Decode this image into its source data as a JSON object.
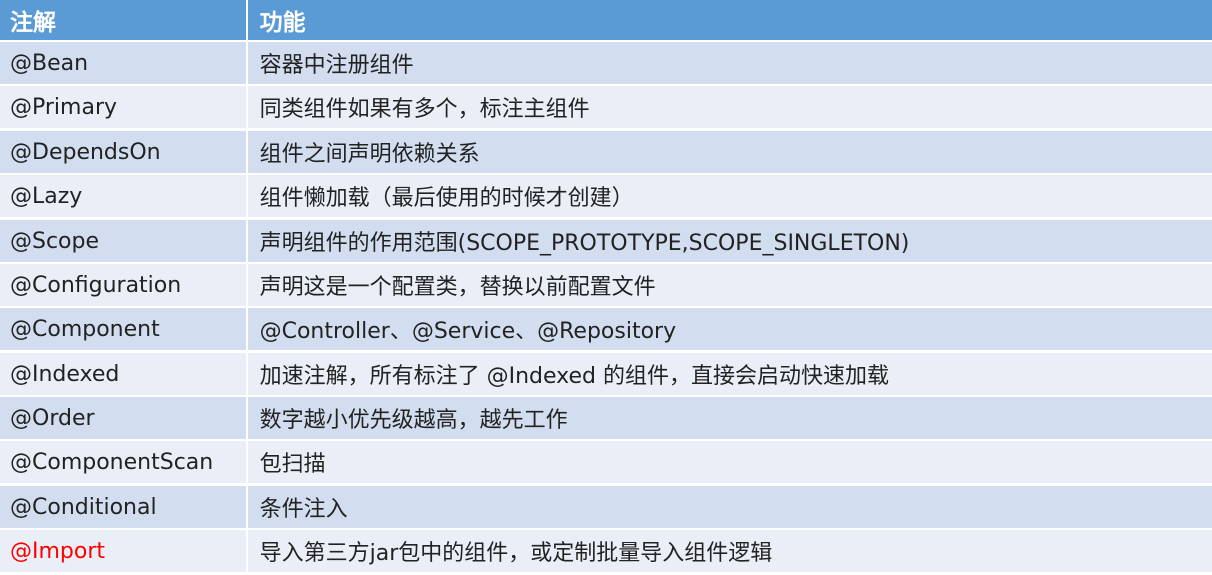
{
  "table": {
    "header": {
      "annotation": "注解",
      "function": "功能"
    },
    "colors": {
      "header_bg": "#5b9bd5",
      "row_odd_bg": "#d2deef",
      "row_even_bg": "#eaeff7",
      "highlight_text": "#ff0000"
    },
    "rows": [
      {
        "annotation": "@Bean",
        "function": "容器中注册组件"
      },
      {
        "annotation": "@Primary",
        "function": "同类组件如果有多个，标注主组件"
      },
      {
        "annotation": "@DependsOn",
        "function": "组件之间声明依赖关系"
      },
      {
        "annotation": "@Lazy",
        "function": "组件懒加载（最后使用的时候才创建）"
      },
      {
        "annotation": "@Scope",
        "function": "声明组件的作用范围(SCOPE_PROTOTYPE,SCOPE_SINGLETON)"
      },
      {
        "annotation": "@Configuration",
        "function": "声明这是一个配置类，替换以前配置文件"
      },
      {
        "annotation": "@Component",
        "function": "@Controller、@Service、@Repository"
      },
      {
        "annotation": "@Indexed",
        "function": "加速注解，所有标注了 @Indexed 的组件，直接会启动快速加载"
      },
      {
        "annotation": "@Order",
        "function": "数字越小优先级越高，越先工作"
      },
      {
        "annotation": "@ComponentScan",
        "function": "包扫描"
      },
      {
        "annotation": "@Conditional",
        "function": "条件注入"
      },
      {
        "annotation": "@Import",
        "function": "导入第三方jar包中的组件，或定制批量导入组件逻辑"
      }
    ]
  }
}
